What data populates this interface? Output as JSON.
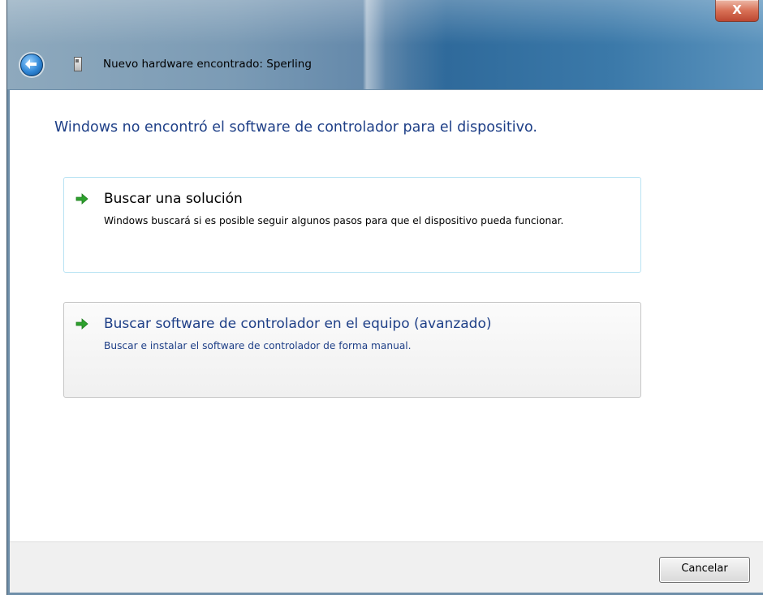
{
  "window": {
    "title": "Nuevo hardware encontrado: Sperling",
    "close_label": "X"
  },
  "content": {
    "heading": "Windows no encontró el software de controlador para el dispositivo.",
    "options": [
      {
        "title": "Buscar una solución",
        "description": "Windows buscará si es posible seguir algunos pasos para que el dispositivo pueda funcionar.",
        "icon": "green-arrow-icon"
      },
      {
        "title": "Buscar software de controlador en el equipo (avanzado)",
        "description": "Buscar e instalar el software de controlador de forma manual.",
        "icon": "green-arrow-icon"
      }
    ]
  },
  "footer": {
    "cancel_label": "Cancelar"
  },
  "colors": {
    "heading_blue": "#1e3f87",
    "arrow_green": "#2da12d",
    "close_red": "#cf4f2e"
  }
}
